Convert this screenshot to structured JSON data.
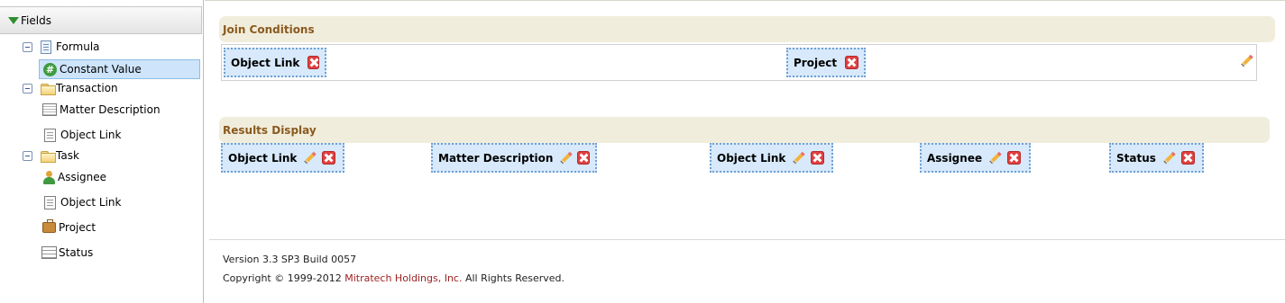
{
  "tree": {
    "header": "Fields",
    "items": [
      {
        "label": "Formula"
      },
      {
        "label": "Constant Value"
      },
      {
        "label": "Transaction"
      },
      {
        "label": "Matter Description"
      },
      {
        "label": "Object Link"
      },
      {
        "label": "Task"
      },
      {
        "label": "Assignee"
      },
      {
        "label": "Object Link"
      },
      {
        "label": "Project"
      },
      {
        "label": "Status"
      }
    ]
  },
  "join": {
    "title": "Join Conditions",
    "chips": [
      {
        "label": "Object Link"
      },
      {
        "label": "Project"
      }
    ]
  },
  "results": {
    "title": "Results Display",
    "chips": [
      {
        "label": "Object Link"
      },
      {
        "label": "Matter Description"
      },
      {
        "label": "Object Link"
      },
      {
        "label": "Assignee"
      },
      {
        "label": "Status"
      }
    ]
  },
  "footer": {
    "version": "Version 3.3 SP3 Build 0057",
    "copyright_prefix": "Copyright © 1999-2012 ",
    "company": "Mitratech Holdings, Inc.",
    "copyright_suffix": " All Rights Reserved."
  },
  "colors": {
    "section_title": "#8a5a1e",
    "section_bg": "#f1eddc",
    "chip_bg": "#d7e9fb",
    "link": "#9c1f1f"
  }
}
